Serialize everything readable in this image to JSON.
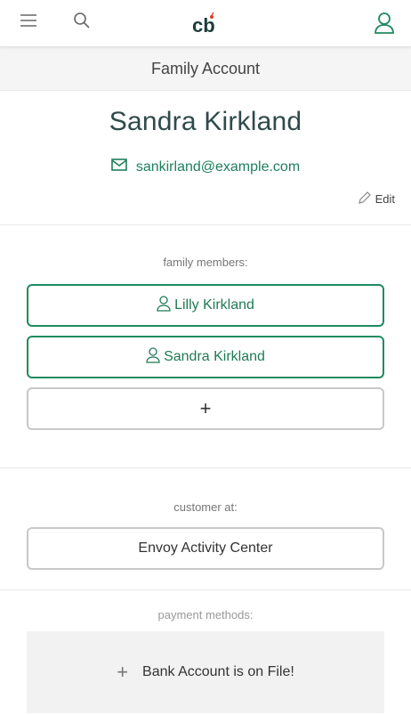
{
  "app": {
    "logo_text": "cb",
    "page_title": "Family Account"
  },
  "profile": {
    "name": "Sandra Kirkland",
    "email": "sankirland@example.com",
    "edit_label": "Edit"
  },
  "family": {
    "label": "family members:",
    "members": [
      "Lilly Kirkland",
      "Sandra Kirkland"
    ],
    "add_label": "+"
  },
  "customer": {
    "label": "customer at:",
    "center": "Envoy Activity Center"
  },
  "payments": {
    "label": "payment methods:",
    "status": "Bank Account is on File!",
    "add_icon": "+"
  },
  "colors": {
    "accent": "#1f8a5f",
    "name_color": "#2f4a4a"
  }
}
